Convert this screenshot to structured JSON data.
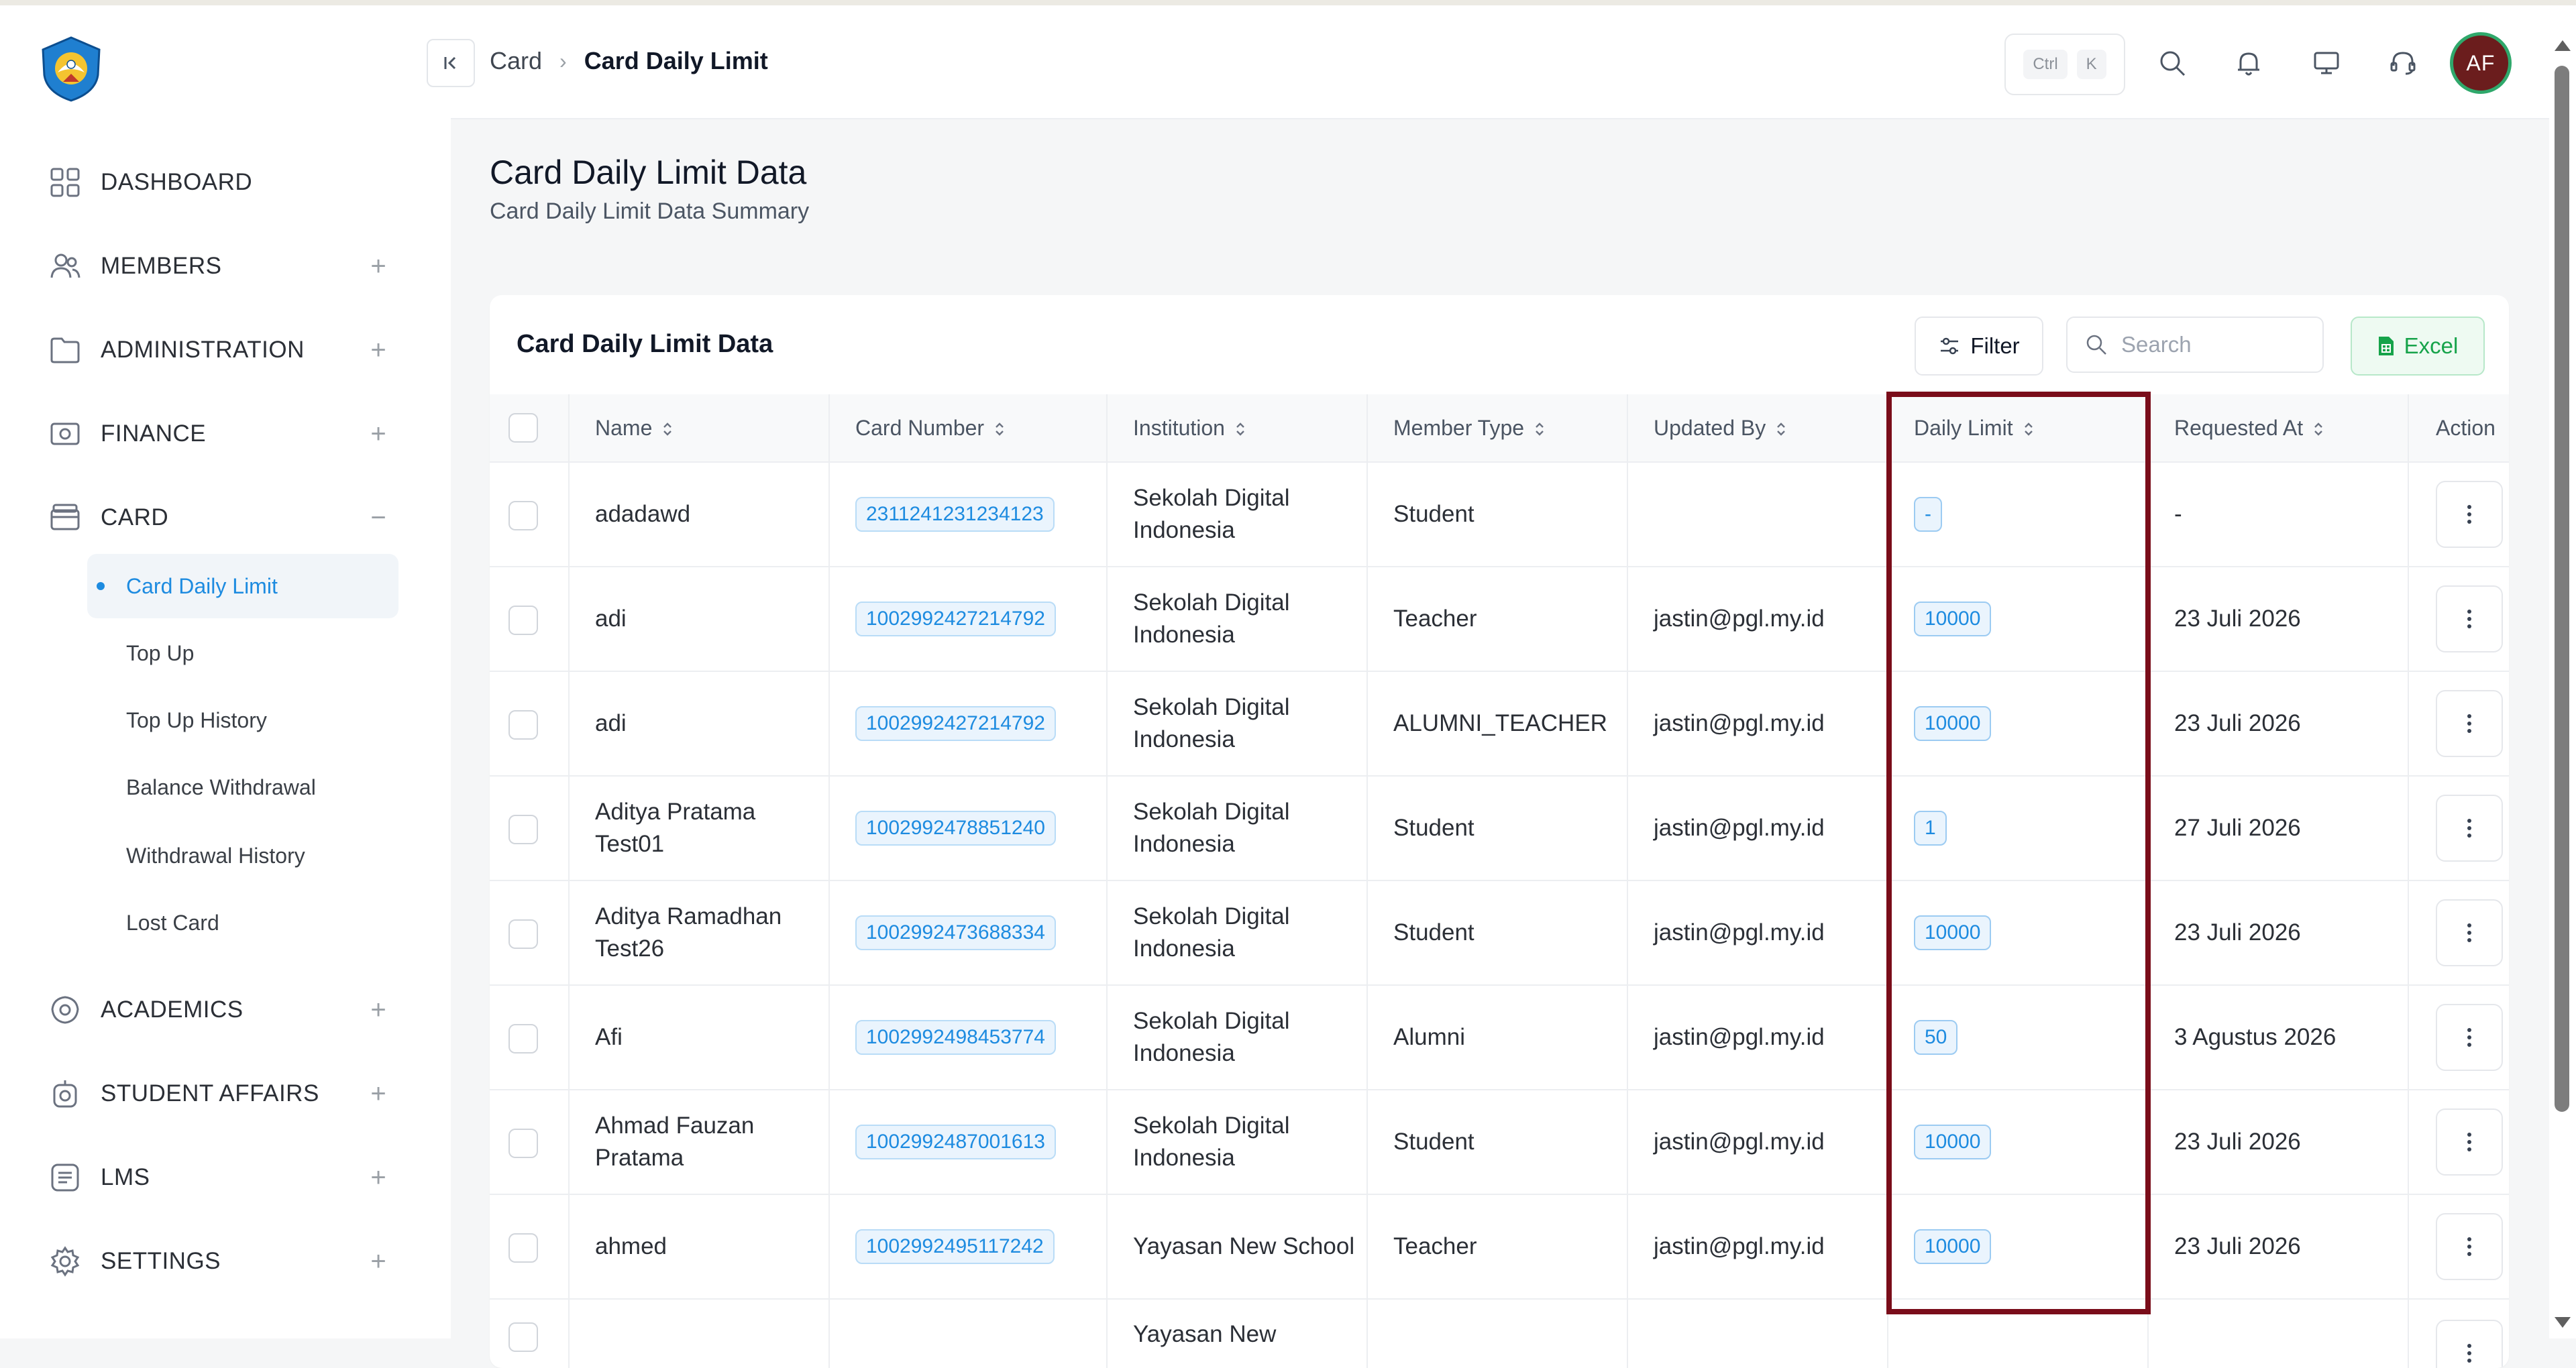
{
  "app": {
    "logo": "tut-wuri-handayani-emblem"
  },
  "sidebar": {
    "items": [
      {
        "label": "DASHBOARD",
        "icon": "dashboard-grid-icon",
        "toggle": ""
      },
      {
        "label": "MEMBERS",
        "icon": "members-icon",
        "toggle": "+"
      },
      {
        "label": "ADMINISTRATION",
        "icon": "folder-icon",
        "toggle": "+"
      },
      {
        "label": "FINANCE",
        "icon": "finance-icon",
        "toggle": "+"
      },
      {
        "label": "CARD",
        "icon": "card-icon",
        "toggle": "−"
      },
      {
        "label": "ACADEMICS",
        "icon": "academics-icon",
        "toggle": "+"
      },
      {
        "label": "STUDENT AFFAIRS",
        "icon": "student-affairs-icon",
        "toggle": "+"
      },
      {
        "label": "LMS",
        "icon": "lms-icon",
        "toggle": "+"
      },
      {
        "label": "SETTINGS",
        "icon": "settings-gear-icon",
        "toggle": "+"
      }
    ],
    "card_subitems": [
      {
        "label": "Card Daily Limit",
        "active": true
      },
      {
        "label": "Top Up",
        "active": false
      },
      {
        "label": "Top Up History",
        "active": false
      },
      {
        "label": "Balance Withdrawal",
        "active": false
      },
      {
        "label": "Withdrawal History",
        "active": false
      },
      {
        "label": "Lost Card",
        "active": false
      }
    ]
  },
  "header": {
    "breadcrumb": [
      "Card",
      "Card Daily Limit"
    ],
    "shortcut": [
      "Ctrl",
      "K"
    ],
    "avatar_initials": "AF"
  },
  "page": {
    "title": "Card Daily Limit Data",
    "subtitle": "Card Daily Limit Data Summary"
  },
  "table_card": {
    "title": "Card Daily Limit Data",
    "filter_label": "Filter",
    "search_placeholder": "Search",
    "excel_label": "Excel",
    "columns": [
      "Name",
      "Card Number",
      "Institution",
      "Member Type",
      "Updated By",
      "Daily Limit",
      "Requested At",
      "Action"
    ],
    "rows": [
      {
        "name": "adadawd",
        "card": "2311241231234123",
        "institution": "Sekolah Digital Indonesia",
        "member_type": "Student",
        "updated_by": "",
        "daily_limit": "-",
        "requested_at": "-"
      },
      {
        "name": "adi",
        "card": "1002992427214792",
        "institution": "Sekolah Digital Indonesia",
        "member_type": "Teacher",
        "updated_by": "jastin@pgl.my.id",
        "daily_limit": "10000",
        "requested_at": "23 Juli 2026"
      },
      {
        "name": "adi",
        "card": "1002992427214792",
        "institution": "Sekolah Digital Indonesia",
        "member_type": "ALUMNI_TEACHER",
        "updated_by": "jastin@pgl.my.id",
        "daily_limit": "10000",
        "requested_at": "23 Juli 2026"
      },
      {
        "name": "Aditya Pratama Test01",
        "card": "1002992478851240",
        "institution": "Sekolah Digital Indonesia",
        "member_type": "Student",
        "updated_by": "jastin@pgl.my.id",
        "daily_limit": "1",
        "requested_at": "27 Juli 2026"
      },
      {
        "name": "Aditya Ramadhan Test26",
        "card": "1002992473688334",
        "institution": "Sekolah Digital Indonesia",
        "member_type": "Student",
        "updated_by": "jastin@pgl.my.id",
        "daily_limit": "10000",
        "requested_at": "23 Juli 2026"
      },
      {
        "name": "Afi",
        "card": "1002992498453774",
        "institution": "Sekolah Digital Indonesia",
        "member_type": "Alumni",
        "updated_by": "jastin@pgl.my.id",
        "daily_limit": "50",
        "requested_at": "3 Agustus 2026"
      },
      {
        "name": "Ahmad Fauzan Pratama",
        "card": "1002992487001613",
        "institution": "Sekolah Digital Indonesia",
        "member_type": "Student",
        "updated_by": "jastin@pgl.my.id",
        "daily_limit": "10000",
        "requested_at": "23 Juli 2026"
      },
      {
        "name": "ahmed",
        "card": "1002992495117242",
        "institution": "Yayasan New School",
        "member_type": "Teacher",
        "updated_by": "jastin@pgl.my.id",
        "daily_limit": "10000",
        "requested_at": "23 Juli 2026"
      },
      {
        "name": "",
        "card": "",
        "institution": "Yayasan New",
        "member_type": "",
        "updated_by": "",
        "daily_limit": "",
        "requested_at": ""
      }
    ]
  },
  "colors": {
    "accent": "#1d8be0",
    "excel_green": "#16a34a",
    "highlight": "#7a0d1a",
    "avatar_bg": "#6b1d1d",
    "avatar_ring": "#2fa86b"
  }
}
